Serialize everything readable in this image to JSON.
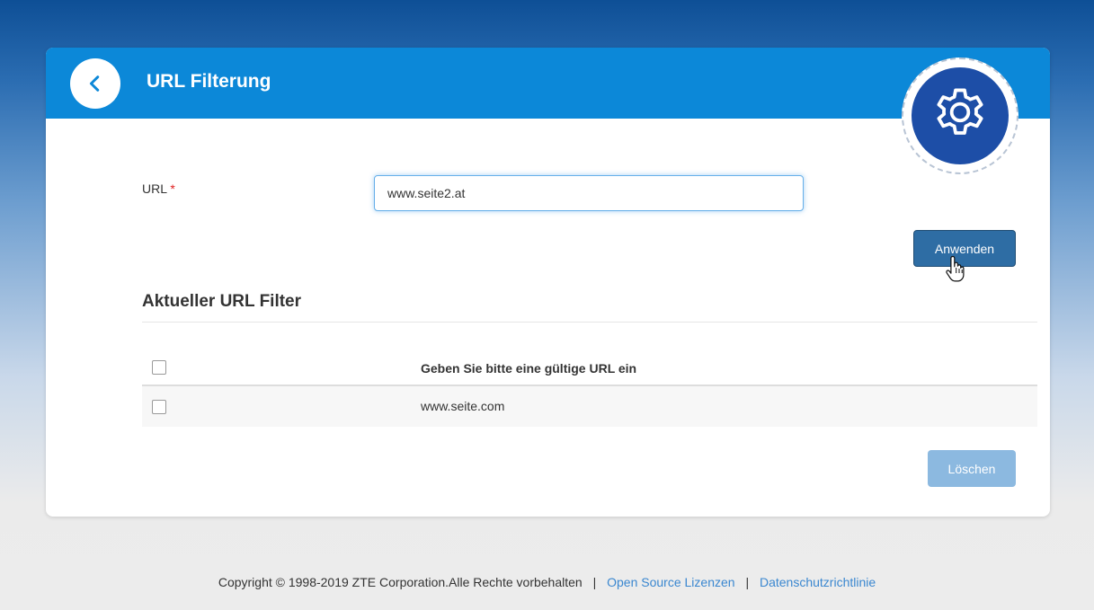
{
  "header": {
    "title": "URL Filterung"
  },
  "form": {
    "url_label": "URL",
    "required_mark": "*",
    "url_value": "www.seite2.at",
    "apply_label": "Anwenden"
  },
  "filter_section": {
    "title": "Aktueller URL Filter",
    "column_header": "Geben Sie bitte eine gültige URL ein",
    "rows": [
      {
        "url": "www.seite.com",
        "checked": false
      }
    ],
    "delete_label": "Löschen"
  },
  "footer": {
    "copyright": "Copyright © 1998-2019 ZTE Corporation.Alle Rechte vorbehalten",
    "open_source_link": "Open Source Lizenzen",
    "privacy_link": "Datenschutzrichtlinie",
    "separator": "|"
  },
  "colors": {
    "header_blue": "#0c88d8",
    "gear_blue": "#1d4ea7",
    "apply_button": "#2e6da4",
    "delete_button_disabled": "#8cb9e0",
    "link": "#3a87d0"
  },
  "icons": {
    "back": "chevron-left-icon",
    "settings": "gear-icon",
    "cursor": "hand-pointer-icon"
  }
}
